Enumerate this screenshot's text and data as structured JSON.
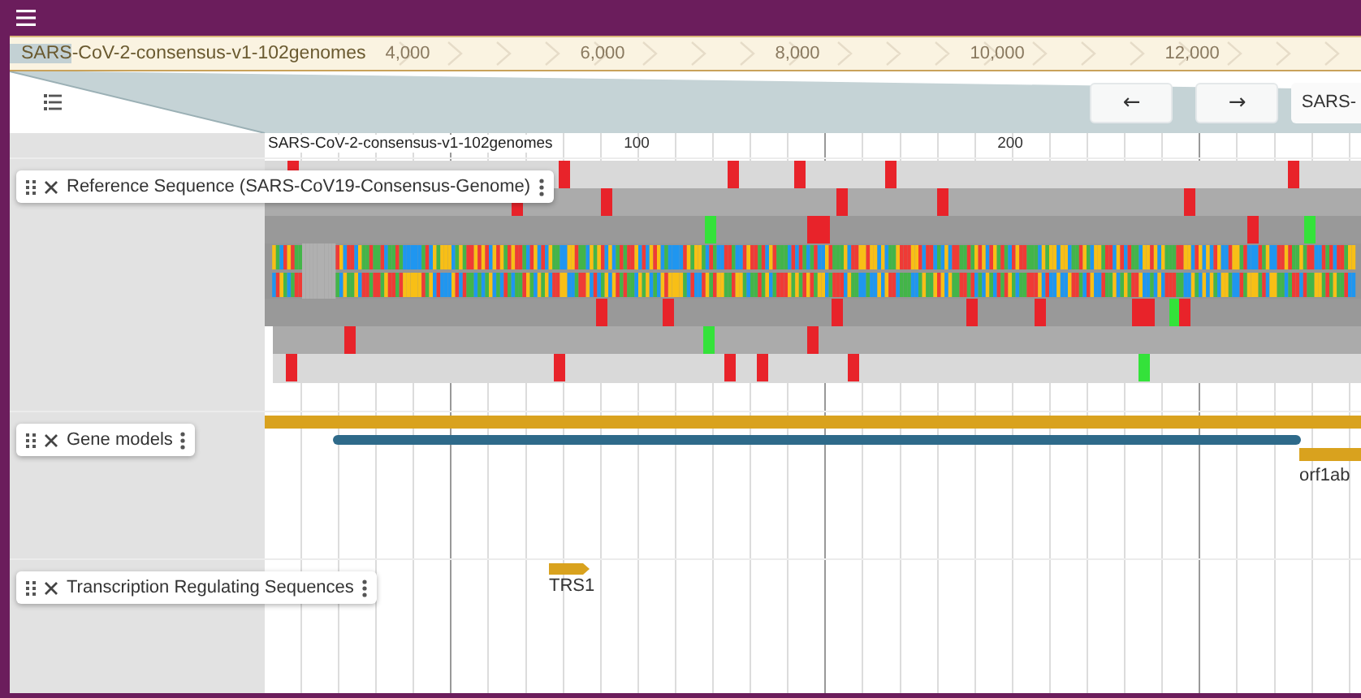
{
  "overview": {
    "assembly_label": "SARS-CoV-2-consensus-v1-102genomes",
    "ticks": [
      "4,000",
      "6,000",
      "8,000",
      "10,000",
      "12,000"
    ]
  },
  "view_header": {
    "nav_buttons": [
      "←",
      "→"
    ],
    "locus": "SARS-"
  },
  "ruler": {
    "refname": "SARS-CoV-2-consensus-v1-102genomes",
    "ticks": [
      "100",
      "200"
    ]
  },
  "tracks": [
    {
      "kind": "sequence",
      "name": "Reference Sequence (SARS-CoV19-Consensus-Genome)"
    },
    {
      "kind": "genes",
      "name": "Gene models",
      "features": [
        {
          "label": "orf1ab"
        }
      ]
    },
    {
      "kind": "features",
      "name": "Transcription Regulating Sequences",
      "features": [
        {
          "label": "TRS1"
        }
      ]
    }
  ]
}
